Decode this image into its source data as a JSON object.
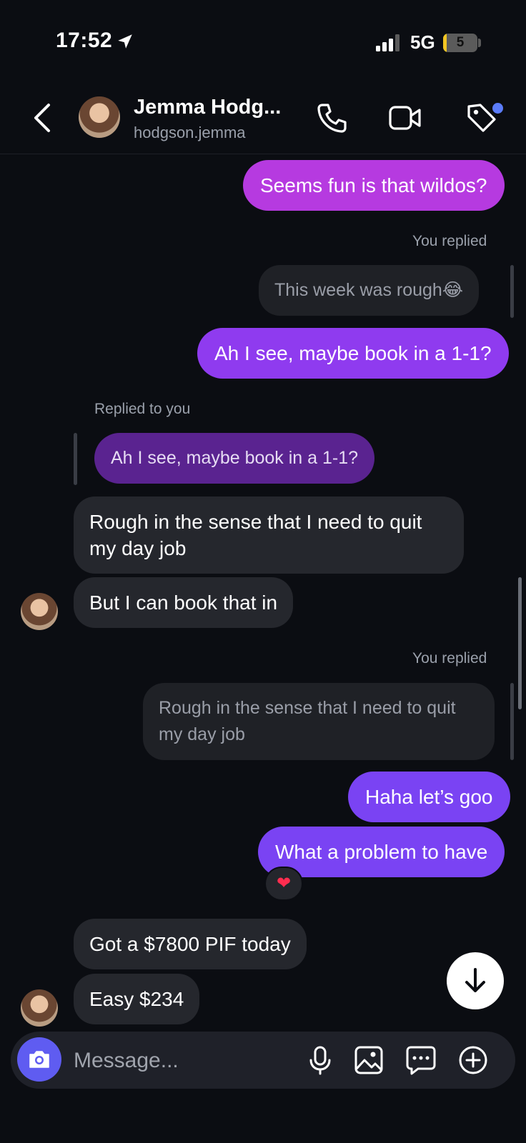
{
  "status_bar": {
    "time": "17:52",
    "network": "5G",
    "battery": "5",
    "battery_fraction": 0.05
  },
  "header": {
    "name": "Jemma Hodg...",
    "username": "hodgson.jemma"
  },
  "messages": {
    "m1": "Seems fun is that wildos?",
    "meta1": "You replied",
    "quote1": "This week was rough😂",
    "m2": "Ah I see, maybe book in a 1-1?",
    "meta2": "Replied to you",
    "quote2": "Ah I see, maybe book in a 1-1?",
    "m3_line1": "Rough in the sense that I need to quit",
    "m3_line2": "my day job",
    "m4": "But I can book that in",
    "meta3": "You replied",
    "quote3_line1": "Rough in the sense that I need to quit",
    "quote3_line2": "my day job",
    "m5": "Haha let’s goo",
    "m6": "What a problem to have",
    "reaction": "❤",
    "m7": "Got a $7800 PIF today",
    "m8": "Easy $234"
  },
  "composer": {
    "placeholder": "Message..."
  },
  "colors": {
    "background": "#0b0d12",
    "outgoing_pink": "#b63ae0",
    "outgoing_violet": "#8f3bef",
    "outgoing_blue": "#7a43f3",
    "incoming": "#25272d",
    "camera_button": "#5f5cf1"
  },
  "icons": [
    "location-arrow-icon",
    "signal-icon",
    "battery-icon",
    "back-chevron-icon",
    "phone-icon",
    "video-icon",
    "tag-icon",
    "heart-icon",
    "arrow-down-icon",
    "camera-icon",
    "microphone-icon",
    "image-icon",
    "sticker-icon",
    "plus-icon"
  ]
}
